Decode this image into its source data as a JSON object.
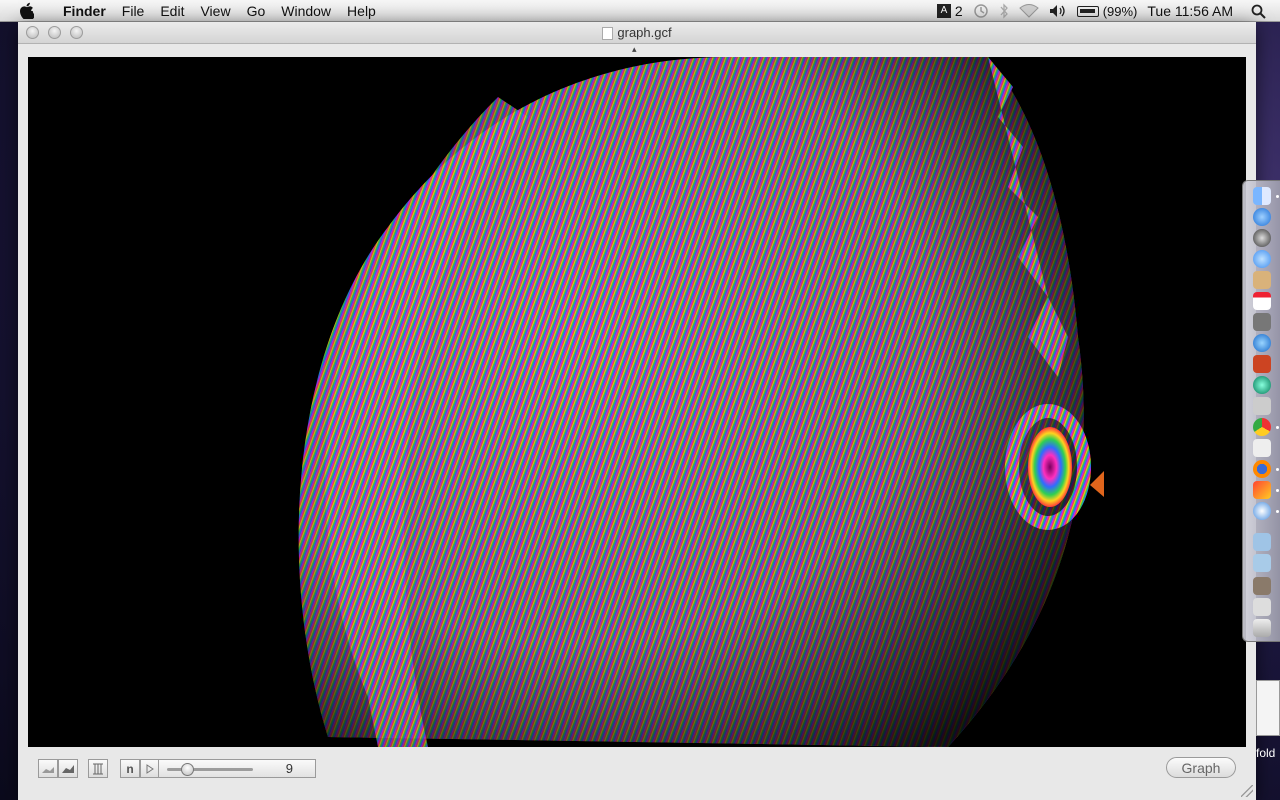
{
  "menubar": {
    "items": [
      "Finder",
      "File",
      "Edit",
      "View",
      "Go",
      "Window",
      "Help"
    ],
    "status": {
      "adobe_count": "2",
      "battery": "(99%)",
      "clock": "Tue 11:56 AM"
    }
  },
  "window": {
    "title": "graph.gcf",
    "slider_value": "9",
    "n_button_label": "n",
    "graph_button_label": "Graph"
  },
  "desktop": {
    "file_label": "fold"
  },
  "colors": {
    "viewport_bg": "#000000",
    "stripe_colors": [
      "#ff2d6a",
      "#ffd21f",
      "#32d24a",
      "#1f8bff",
      "#b02fff"
    ]
  }
}
